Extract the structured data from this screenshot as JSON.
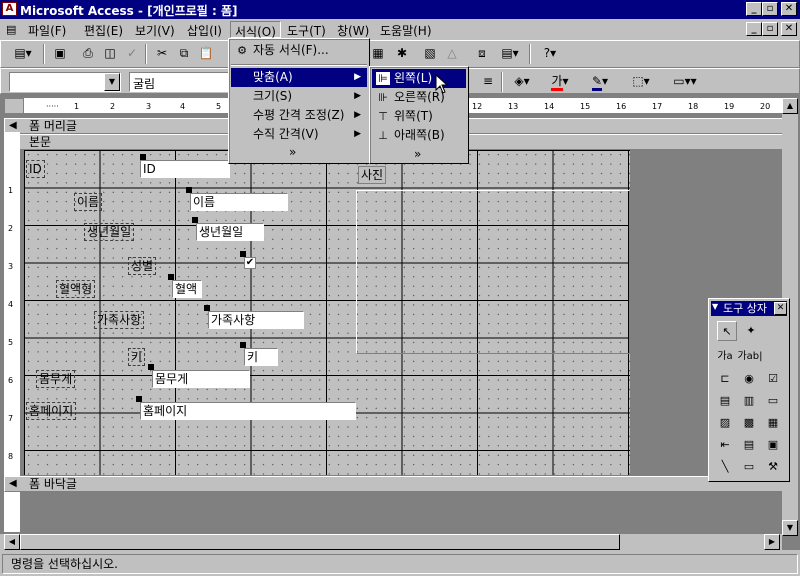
{
  "window": {
    "title": "Microsoft Access - [개인프로필 : 폼]",
    "app_icon": "access-key-icon",
    "caption_buttons": [
      "_",
      "▫",
      "✕"
    ]
  },
  "menubar": {
    "items": [
      "파일(F)",
      "편집(E)",
      "보기(V)",
      "삽입(I)",
      "서식(O)",
      "도구(T)",
      "창(W)",
      "도움말(H)"
    ],
    "active": "서식(O)",
    "doc_buttons": [
      "_",
      "▫",
      "✕"
    ]
  },
  "toolbar_formatting": {
    "object_combo": "",
    "font_combo": "굴림"
  },
  "format_menu": {
    "items": [
      {
        "label": "자동 서식(F)...",
        "icon": "autoformat-icon"
      },
      {
        "label": "맞춤(A)",
        "submenu": true,
        "selected": true
      },
      {
        "label": "크기(S)",
        "submenu": true
      },
      {
        "label": "수평 간격 조정(Z)",
        "submenu": true
      },
      {
        "label": "수직 간격(V)",
        "submenu": true
      }
    ],
    "more": "»"
  },
  "align_submenu": {
    "items": [
      {
        "label": "왼쪽(L)",
        "icon": "align-left-icon",
        "selected": true
      },
      {
        "label": "오른쪽(R)",
        "icon": "align-right-icon"
      },
      {
        "label": "위쪽(T)",
        "icon": "align-top-icon"
      },
      {
        "label": "아래쪽(B)",
        "icon": "align-bottom-icon"
      }
    ],
    "more": "»"
  },
  "ruler": {
    "top_ticks": [
      "1",
      "2",
      "3",
      "4",
      "5",
      "12",
      "13",
      "14",
      "15",
      "16",
      "17",
      "18",
      "19",
      "20"
    ],
    "left_ticks": [
      "1",
      "2",
      "3",
      "4",
      "5",
      "6",
      "7",
      "8"
    ]
  },
  "sections": {
    "header": "폼 머리글",
    "detail": "본문",
    "footer": "폼 바닥글"
  },
  "controls": {
    "labels": [
      "ID",
      "이름",
      "생년월일",
      "성별",
      "혈액형",
      "가족사항",
      "키",
      "몸무게",
      "홈페이지",
      "사진"
    ],
    "fields": [
      "ID",
      "이름",
      "생년월일",
      "혈액",
      "가족사항",
      "키",
      "몸무게",
      "홈페이지"
    ],
    "checkbox_checked": true
  },
  "toolbox": {
    "title": "도구 상자",
    "tools": [
      "select-icon",
      "wizard-icon",
      "label-icon",
      "textbox-icon",
      "option-group-icon",
      "toggle-icon",
      "option-button-icon",
      "checkbox-icon",
      "combo-icon",
      "list-icon",
      "command-button-icon",
      "image-icon",
      "unbound-object-icon",
      "bound-object-icon",
      "page-break-icon",
      "tab-control-icon",
      "subform-icon",
      "line-icon",
      "rectangle-icon",
      "more-controls-icon"
    ],
    "text_tools": [
      "가a",
      "가ab|"
    ]
  },
  "status": {
    "text": "명령을 선택하십시오."
  },
  "colors": {
    "titlebar": "#000080",
    "face": "#c0c0c0",
    "workspace": "#808080"
  }
}
